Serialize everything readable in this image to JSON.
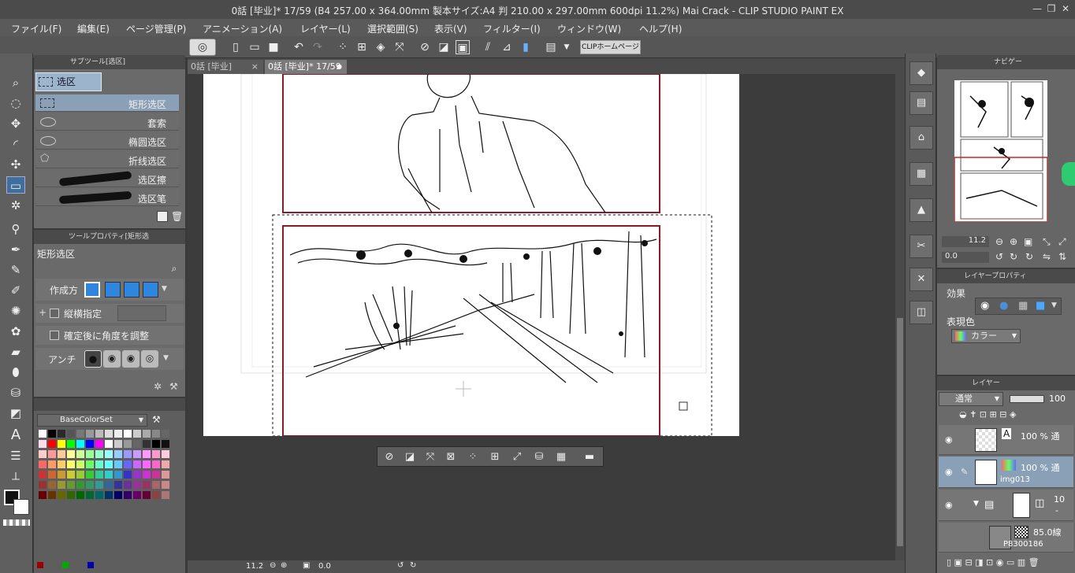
{
  "window": {
    "title": "0話 [毕业]* 17/59 (B4 257.00 x 364.00mm 製本サイズ:A4 判 210.00 x 297.00mm 600dpi 11.2%)  Mai Crack - CLIP STUDIO PAINT EX",
    "min": "—",
    "max": "❐",
    "close": "✕"
  },
  "menu": [
    "ファイル(F)",
    "編集(E)",
    "ページ管理(P)",
    "アニメーション(A)",
    "レイヤー(L)",
    "選択範囲(S)",
    "表示(V)",
    "フィルター(I)",
    "ウィンドウ(W)",
    "ヘルプ(H)"
  ],
  "toolbar": {
    "clip_home": "CLIPホームページ"
  },
  "subtool": {
    "header": "サブツール[选区]",
    "group": "选区",
    "items": [
      "矩形选区",
      "套索",
      "椭圆选区",
      "折线选区",
      "选区擦",
      "选区笔"
    ]
  },
  "toolprop": {
    "header": "ツールプロパティ[矩形选",
    "title": "矩形选区",
    "create_label": "作成方",
    "aspect_label": "縦横指定",
    "angle_label": "確定後に角度を調整",
    "antialias_label": "アンチ"
  },
  "colorset": {
    "name": "BaseColorSet"
  },
  "tabs": [
    {
      "label": "0話 [毕业]"
    },
    {
      "label": "0話 [毕业]* 17/59"
    }
  ],
  "tab_close": "×",
  "status": {
    "zoom": "11.2",
    "angle": "0.0"
  },
  "navigator": {
    "header": "ナビゲー",
    "zoom": "11.2",
    "angle": "0.0"
  },
  "layer_property": {
    "header": "レイヤープロパティ",
    "effect_label": "効果",
    "color_label": "表現色",
    "color_value": "カラー"
  },
  "layer_panel": {
    "header": "レイヤー",
    "blend": "通常",
    "opacity": "100",
    "layers": [
      {
        "opacity": "100 % 通",
        "name": ""
      },
      {
        "opacity": "100 % 通",
        "name": "img013"
      },
      {
        "opacity": "10",
        "name": "-"
      },
      {
        "opacity": "85.0線",
        "name": "P8300186"
      }
    ]
  },
  "colors": {
    "accent": "#4a90d9",
    "frame": "#8b1a2b",
    "nav_frame": "#cc2222",
    "green_badge": "#2ecc71"
  }
}
